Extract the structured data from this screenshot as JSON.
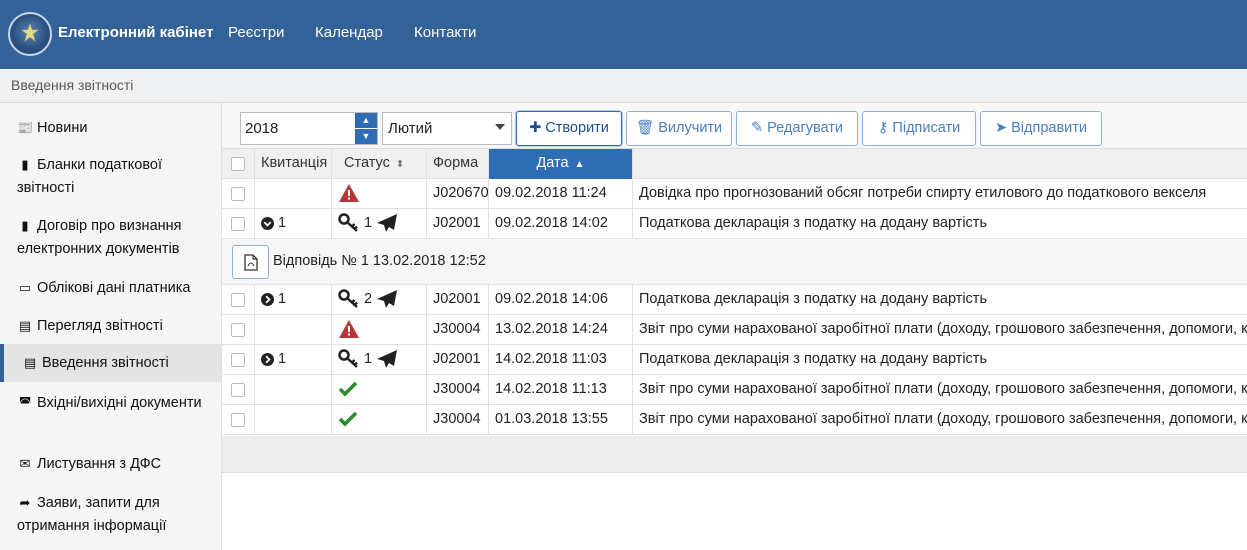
{
  "app": {
    "brand": "Електронний кабінет",
    "nav": [
      "Реєстри",
      "Календар",
      "Контакти"
    ]
  },
  "breadcrumb": "Введення звітності",
  "sidebar": {
    "items": [
      {
        "label": "Новини",
        "icon": "newspaper-icon"
      },
      {
        "label": "Бланки податкової звітності",
        "icon": "document-icon"
      },
      {
        "label": "Договір про визнання електронних документів",
        "icon": "document-icon"
      },
      {
        "label": "Облікові дані платника",
        "icon": "id-card-icon"
      },
      {
        "label": "Перегляд звітності",
        "icon": "file-text-icon"
      },
      {
        "label": "Введення звітності",
        "icon": "form-icon",
        "active": true
      },
      {
        "label": "Вхідні/вихідні документи",
        "icon": "inbox-icon"
      },
      {
        "label": "Листування з ДФС",
        "icon": "envelope-icon"
      },
      {
        "label": "Заяви, запити для отримання інформації",
        "icon": "share-icon"
      }
    ]
  },
  "toolbar": {
    "year": "2018",
    "month": "Лютий",
    "create": "Створити",
    "delete": "Вилучити",
    "edit": "Редагувати",
    "sign": "Підписати",
    "send": "Відправити"
  },
  "table": {
    "headers": {
      "receipt": "Квитанція",
      "status": "Статус",
      "form": "Форма",
      "date": "Дата"
    },
    "rows": [
      {
        "receipt": "",
        "receipt_icon": "",
        "status_icon": "warning-icon",
        "sign_count": "",
        "form": "J020670",
        "date": "09.02.2018 11:24",
        "desc": "Довідка про прогнозований обсяг потреби спирту етилового до податкового векселя"
      },
      {
        "receipt": "1",
        "receipt_icon": "chevron-down-circle-icon",
        "status_icon": "key-sent-icon",
        "sign_count": "1",
        "form": "J02001",
        "date": "09.02.2018 14:02",
        "desc": "Податкова декларація з податку на додану вартість"
      },
      {
        "receipt": "1",
        "receipt_icon": "chevron-right-circle-icon",
        "status_icon": "key-sent-icon",
        "sign_count": "2",
        "form": "J02001",
        "date": "09.02.2018 14:06",
        "desc": "Податкова декларація з податку на додану вартість"
      },
      {
        "receipt": "",
        "receipt_icon": "",
        "status_icon": "warning-icon",
        "sign_count": "",
        "form": "J30004",
        "date": "13.02.2018 14:24",
        "desc": "Звіт про суми нарахованої заробітної плати (доходу, грошового забезпечення, допомоги, компенсації)"
      },
      {
        "receipt": "1",
        "receipt_icon": "chevron-right-circle-icon",
        "status_icon": "key-sent-icon",
        "sign_count": "1",
        "form": "J02001",
        "date": "14.02.2018 11:03",
        "desc": "Податкова декларація з податку на додану вартість"
      },
      {
        "receipt": "",
        "receipt_icon": "",
        "status_icon": "check-icon",
        "sign_count": "",
        "form": "J30004",
        "date": "14.02.2018 11:13",
        "desc": "Звіт про суми нарахованої заробітної плати (доходу, грошового забезпечення, допомоги, компенсації)"
      },
      {
        "receipt": "",
        "receipt_icon": "",
        "status_icon": "check-icon",
        "sign_count": "",
        "form": "J30004",
        "date": "01.03.2018 13:55",
        "desc": "Звіт про суми нарахованої заробітної плати (доходу, грошового забезпечення, допомоги, компенсації)"
      }
    ],
    "reply": "Відповідь № 1 13.02.2018 12:52"
  },
  "colors": {
    "header_bg": "#336298",
    "accent": "#2e6db4",
    "warning": "#b03a3a",
    "success": "#2a8a2a"
  }
}
